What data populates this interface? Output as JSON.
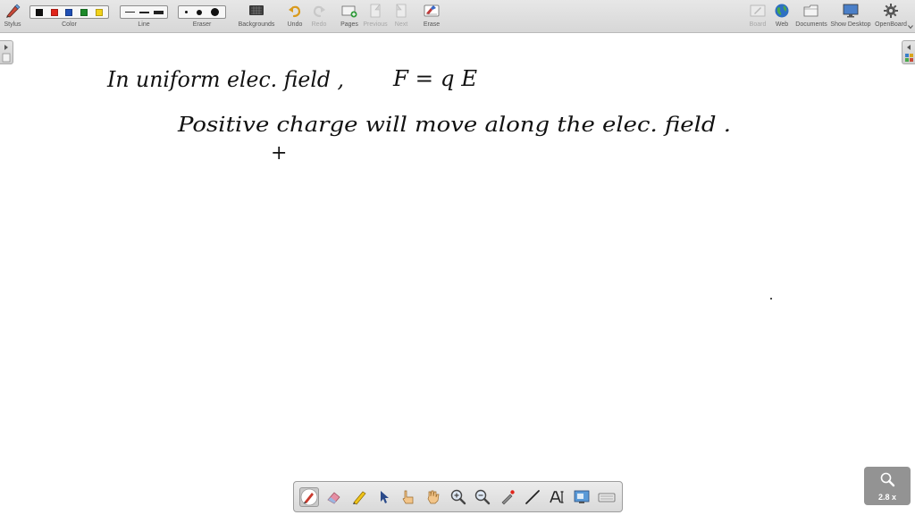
{
  "toolbar": {
    "stylus": "Stylus",
    "color": "Color",
    "line": "Line",
    "eraser": "Eraser",
    "backgrounds": "Backgrounds",
    "undo": "Undo",
    "redo": "Redo",
    "pages": "Pages",
    "previous": "Previous",
    "next": "Next",
    "erase": "Erase",
    "board": "Board",
    "web": "Web",
    "documents": "Documents",
    "show_desktop": "Show Desktop",
    "openboard": "OpenBoard"
  },
  "colors": {
    "palette": [
      "#111111",
      "#e0251b",
      "#1f4fb5",
      "#1d8a2a",
      "#f2d21a"
    ],
    "ink": "#111111"
  },
  "board": {
    "line1_left": "In uniform elec. field ,",
    "line1_eq": "F = q E",
    "line2": "Positive charge will move along the elec. field .",
    "mark": "+"
  },
  "dock": {
    "tools": [
      "pen-tool",
      "eraser-tool",
      "marker-tool",
      "selector-tool",
      "interactor-tool",
      "hand-tool",
      "zoom-in-tool",
      "zoom-out-tool",
      "laser-pointer-tool",
      "line-tool",
      "text-tool",
      "capture-tool",
      "virtual-keyboard-tool"
    ]
  },
  "zoom": {
    "label": "2.8 x"
  }
}
